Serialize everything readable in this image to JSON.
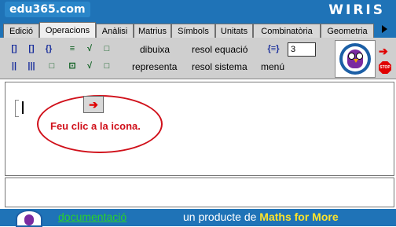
{
  "header": {
    "brand": "edu365.com",
    "product": "WIRIS"
  },
  "tabs": [
    {
      "label": "Edició"
    },
    {
      "label": "Operacions"
    },
    {
      "label": "Anàlisi"
    },
    {
      "label": "Matrius"
    },
    {
      "label": "Símbols"
    },
    {
      "label": "Unitats"
    },
    {
      "label": "Combinatòria"
    },
    {
      "label": "Geometria"
    }
  ],
  "active_tab": "Operacions",
  "toolbar": {
    "dibuixa": "dibuixa",
    "representa": "representa",
    "resol_equacio": "resol equació",
    "resol_sistema": "resol sistema",
    "menu": "menú",
    "size_value": "3"
  },
  "editor": {
    "hint": "Feu clic a la icona."
  },
  "footer": {
    "doc_link": "documentació",
    "text_prefix": "un producte de ",
    "brand": "Maths for More"
  },
  "colors": {
    "header_bg": "#1f73b7",
    "accent_red": "#d0101a",
    "doc_link": "#2ad12a",
    "brand_yellow": "#ffe42a"
  },
  "icons": [
    "brackets-icon",
    "vector-icon",
    "matrix-icon",
    "fraction-icon",
    "sqrt-icon",
    "superscript-icon",
    "nth-root-icon",
    "subscript-icon",
    "stop-icon",
    "arrow-right-icon",
    "owl-logo-icon"
  ]
}
